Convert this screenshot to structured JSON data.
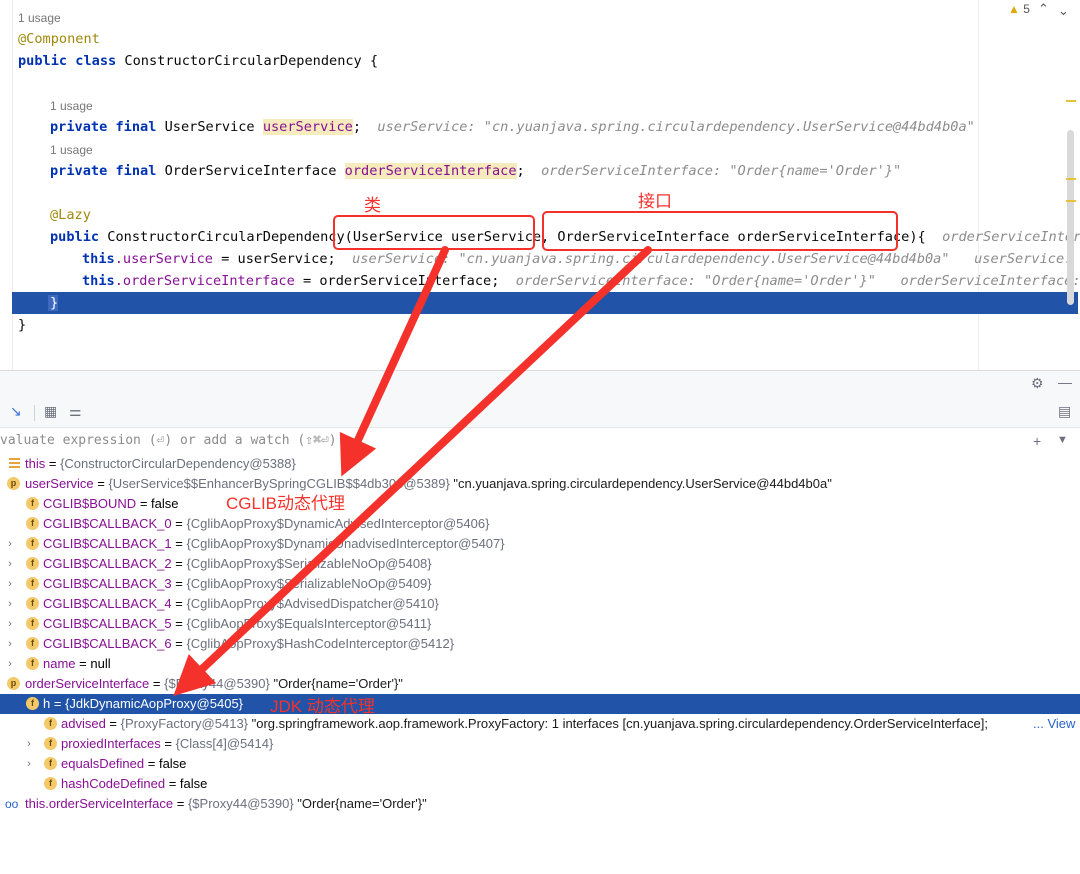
{
  "editor": {
    "usage_1": "1 usage",
    "usage_2": "1 usage",
    "usage_3": "1 usage",
    "annotation_component": "@Component",
    "kw_public": "public",
    "kw_class": "class",
    "class_name": " ConstructorCircularDependency {",
    "kw_private": "private",
    "kw_final": "final",
    "type_userservice": " UserService ",
    "field_userservice": "userService",
    "semicolon": ";",
    "hint_userservice": "userService: \"cn.yuanjava.spring.circulardependency.UserService@44bd4b0a\"",
    "type_orderservice": " OrderServiceInterface ",
    "field_orderservice": "orderServiceInterface",
    "hint_orderservice": "orderServiceInterface: \"Order{name='Order'}\"",
    "annotation_lazy": "@Lazy",
    "ctor_prefix": " ConstructorCircularDependency",
    "ctor_param1": "(UserService userService,",
    "ctor_param2": " OrderServiceInterface orderServiceInterface",
    "ctor_brace": "){",
    "hint_ctor": "orderServiceInterfa",
    "kw_this": "this",
    "assign_user": " = userService;",
    "hint_assign_user_1": "userService: \"cn.yuanjava.spring.circulardependency.UserService@44bd4b0a\"",
    "hint_assign_user_2": "userService: \"c",
    "assign_order": " = orderServiceInterface;",
    "hint_assign_order_1": "orderServiceInterface: \"Order{name='Order'}\"",
    "hint_assign_order_2": "orderServiceInterface: ",
    "close_brace_inner": "}",
    "close_brace_outer": "}",
    "dot_userservice": ".userService",
    "dot_orderservice": ".orderServiceInterface",
    "warning_count": "5",
    "warning_icon": "warning-triangle-icon",
    "nav_up_icon": "chevron-up-icon",
    "nav_down_icon": "chevron-down-icon"
  },
  "annotations": {
    "label_class": "类",
    "label_interface": "接口",
    "label_cglib": "CGLIB动态代理",
    "label_jdk": "JDK 动态代理",
    "color": "#f4322b"
  },
  "debugger": {
    "settings_icon": "gear-icon",
    "minimize_icon": "minus-icon",
    "layout_icon": "layout-icon",
    "expression_placeholder": "valuate expression (⏎) or add a watch (⇧⌘⏎)",
    "add_watch_icon": "plus-icon",
    "dropdown_icon": "chevron-down-icon",
    "accent": "#2154a8",
    "variables": [
      {
        "name": "this",
        "eq": " = ",
        "type": "{ConstructorCircularDependency@5388}",
        "value": ""
      },
      {
        "name": "userService",
        "eq": " = ",
        "type": "{UserService$$EnhancerBySpringCGLIB$$4",
        "type_tail": "db306@5389}",
        "value": " \"cn.yuanjava.spring.circulardependency.UserService@44bd4b0a\""
      },
      {
        "name": "CGLIB$BOUND",
        "eq": " = ",
        "type": "",
        "value": "false"
      },
      {
        "name": "CGLIB$CALLBACK_0",
        "eq": " = ",
        "type": "{CglibAopProxy$DynamicAdvisedInterceptor@5406}",
        "value": ""
      },
      {
        "name": "CGLIB$CALLBACK_1",
        "eq": " = ",
        "type": "{CglibAopProxy$DynamicUnadvisedInterceptor@5407}",
        "value": ""
      },
      {
        "name": "CGLIB$CALLBACK_2",
        "eq": " = ",
        "type": "{CglibAopProxy$SerializableNoOp@5408}",
        "value": ""
      },
      {
        "name": "CGLIB$CALLBACK_3",
        "eq": " = ",
        "type": "{CglibAopProxy$SerializableNoOp@5409}",
        "value": ""
      },
      {
        "name": "CGLIB$CALLBACK_4",
        "eq": " = ",
        "type": "{CglibAopProxy$AdvisedDispatcher@5410}",
        "value": ""
      },
      {
        "name": "CGLIB$CALLBACK_5",
        "eq": " = ",
        "type": "{CglibAopProxy$EqualsInterceptor@5411}",
        "value": ""
      },
      {
        "name": "CGLIB$CALLBACK_6",
        "eq": " = ",
        "type": "{CglibAopProxy$HashCodeInterceptor@5412}",
        "value": ""
      },
      {
        "name": "name",
        "eq": " = ",
        "type": "",
        "value": "null"
      },
      {
        "name": "orderServiceInterface",
        "eq": " = ",
        "type": "{$Proxy44@5390}",
        "value": " \"Order{name='Order'}\""
      },
      {
        "name": "h",
        "eq": " = ",
        "type": "{JdkDynamicAopProxy@5405}",
        "value": ""
      },
      {
        "name": "advised",
        "eq": " = ",
        "type": "{ProxyFactory@5413}",
        "value": " \"org.springframework.aop.framework.ProxyFactory: 1 interfaces [cn.yuanjava.spring.circulardependency.OrderServiceInterface];",
        "more": "... View"
      },
      {
        "name": "proxiedInterfaces",
        "eq": " = ",
        "type": "{Class[4]@5414}",
        "value": ""
      },
      {
        "name": "equalsDefined",
        "eq": " = ",
        "type": "",
        "value": "false"
      },
      {
        "name": "hashCodeDefined",
        "eq": " = ",
        "type": "",
        "value": "false"
      },
      {
        "name": "this.orderServiceInterface",
        "eq": " = ",
        "type": "{$Proxy44@5390}",
        "value": " \"Order{name='Order'}\""
      }
    ]
  }
}
